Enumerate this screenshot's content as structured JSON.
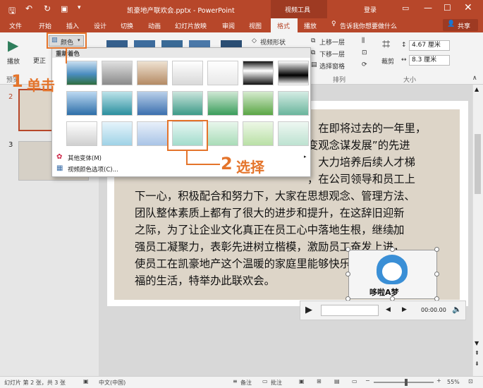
{
  "title_bar": {
    "document_title": "凯豪地产联欢会.pptx - PowerPoint",
    "context_tab": "视频工具",
    "login": "登录"
  },
  "tabs": [
    "文件",
    "开始",
    "插入",
    "设计",
    "切换",
    "动画",
    "幻灯片放映",
    "审阅",
    "视图",
    "格式",
    "播放"
  ],
  "tell_me": "告诉我你想要做什么",
  "share": "共享",
  "ribbon": {
    "play_label": "播放",
    "preview_group": "预览",
    "color_button": "颜色",
    "correct_label": "更正",
    "video_shape": "视频形状",
    "bring_forward": "上移一层",
    "send_backward": "下移一层",
    "selection_pane": "选择窗格",
    "arrange_group": "排列",
    "crop_label": "裁剪",
    "height_value": "4.67 厘米",
    "width_value": "8.3 厘米",
    "size_group": "大小"
  },
  "dropdown": {
    "recolor_header": "重新着色",
    "more_variations": "其他变体(M)",
    "color_options": "视频颜色选项(C)..."
  },
  "annotations": {
    "step1_num": "1",
    "step1_text": "单击",
    "step2_num": "2",
    "step2_text": "选择"
  },
  "slide_numbers": [
    "2",
    "3"
  ],
  "slide": {
    "partial_lines": [
      "，在即将过去的一年里，",
      "变观念谋发展”的先进",
      "，大力培养后续人才梯",
      "，在公司领导和员工上"
    ],
    "body_lines": [
      "下一心，积极配合和努力下，大家在思想观念、管理方法、",
      "团队整体素质上都有了很大的进步和提升，在这辞旧迎新",
      "之际，为了让企业文化真正在员工心中落地生根，继续加",
      "强员工凝聚力，表彰先进树立楷模，激励员工奋发上进，",
      "使员工在凯豪地产这个温暖的家庭里能够快乐的工作，幸",
      "福的生活，特举办此联欢会。"
    ],
    "video_caption": "哆啦A梦",
    "video_time": "00:00.00"
  },
  "status": {
    "slide_info": "幻灯片 第 2 张，共 3 张",
    "language": "中文(中国)",
    "notes": "备注",
    "comments": "批注",
    "zoom": "55%"
  },
  "colors": {
    "accent": "#b7472a",
    "annotation": "#e4742b"
  }
}
